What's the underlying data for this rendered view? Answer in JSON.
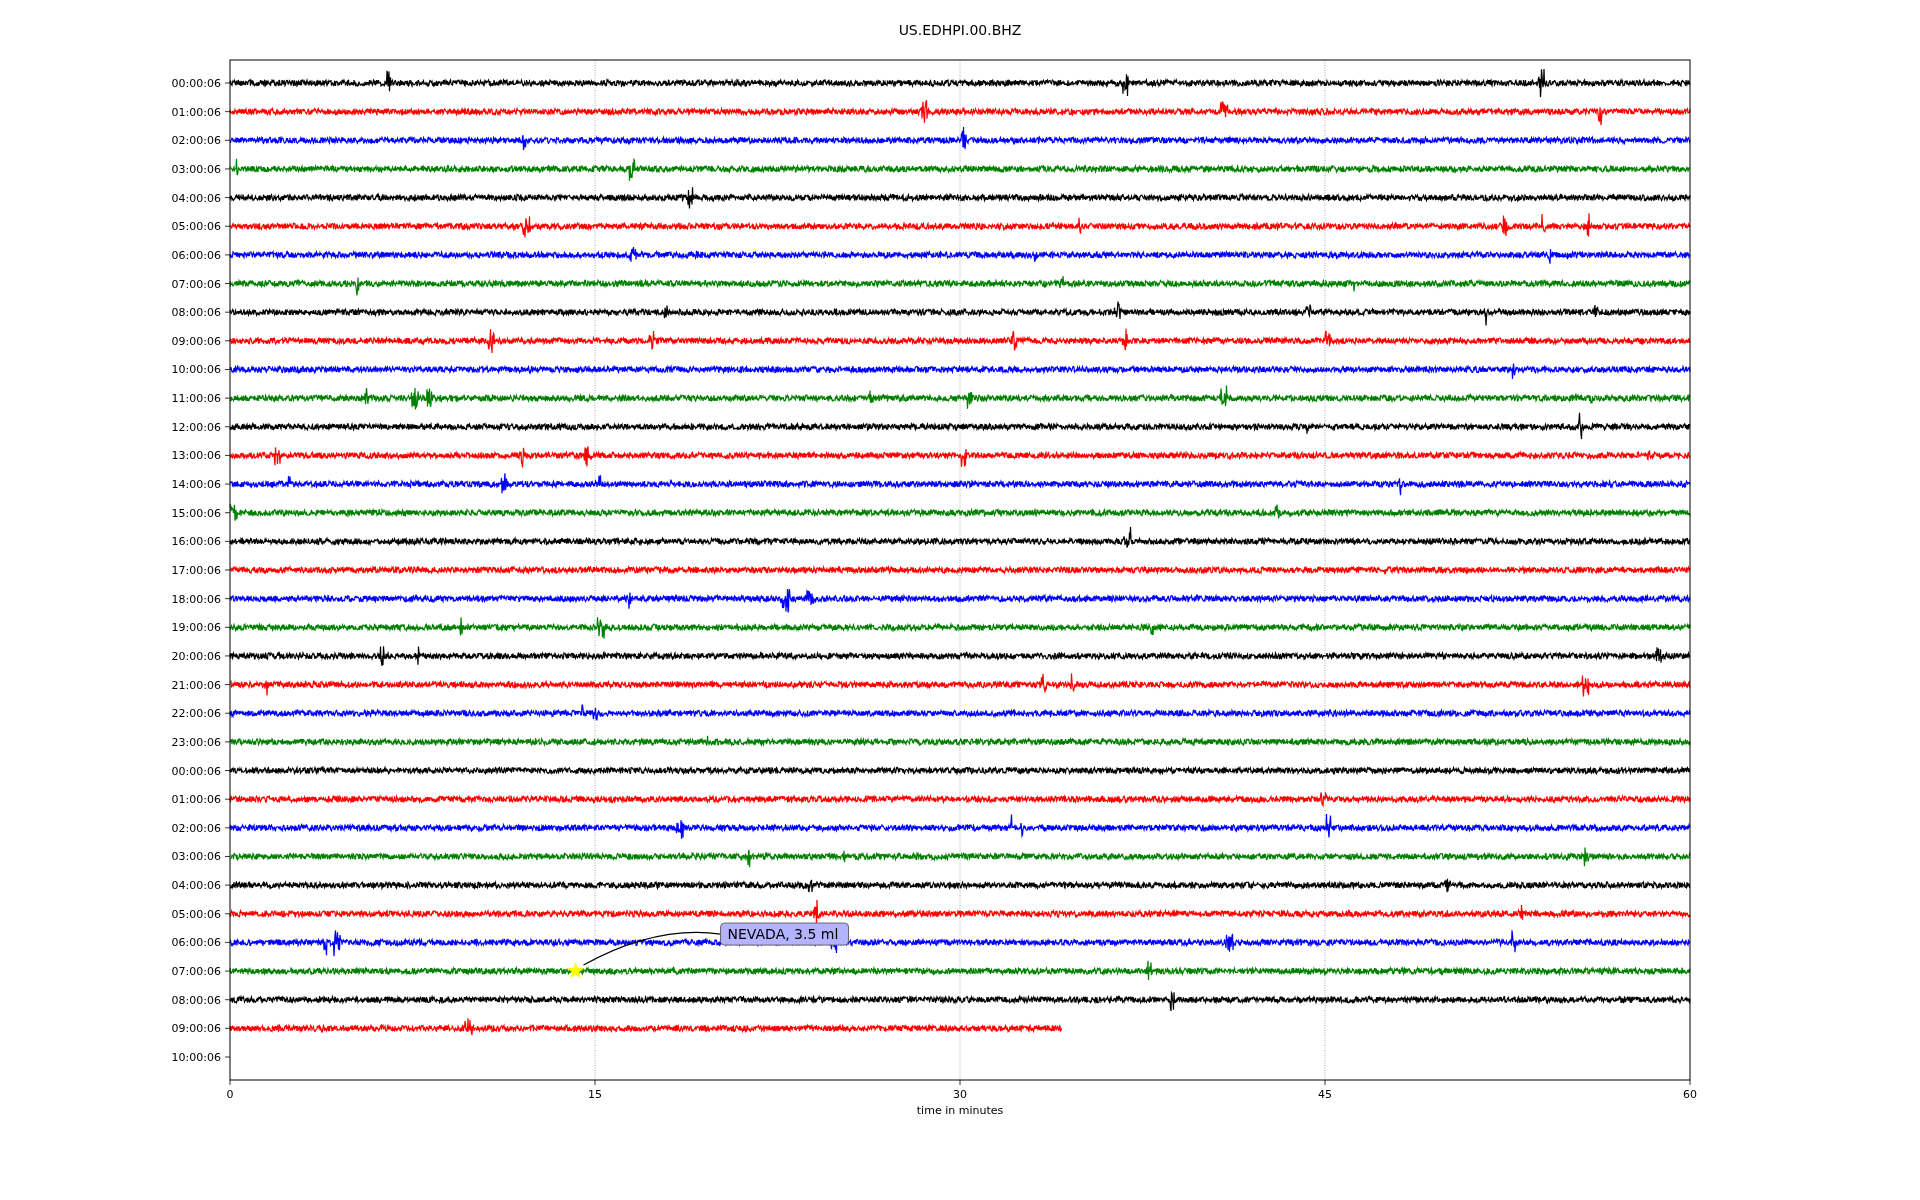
{
  "title": "US.EDHPI.00.BHZ",
  "xlabel": "time in minutes",
  "xticks": [
    "0",
    "15",
    "30",
    "45",
    "60"
  ],
  "rows": [
    {
      "label": "00:00:06",
      "color": "#000000"
    },
    {
      "label": "01:00:06",
      "color": "#ff0000"
    },
    {
      "label": "02:00:06",
      "color": "#0000ff"
    },
    {
      "label": "03:00:06",
      "color": "#008000"
    },
    {
      "label": "04:00:06",
      "color": "#000000"
    },
    {
      "label": "05:00:06",
      "color": "#ff0000"
    },
    {
      "label": "06:00:06",
      "color": "#0000ff"
    },
    {
      "label": "07:00:06",
      "color": "#008000"
    },
    {
      "label": "08:00:06",
      "color": "#000000"
    },
    {
      "label": "09:00:06",
      "color": "#ff0000"
    },
    {
      "label": "10:00:06",
      "color": "#0000ff"
    },
    {
      "label": "11:00:06",
      "color": "#008000"
    },
    {
      "label": "12:00:06",
      "color": "#000000"
    },
    {
      "label": "13:00:06",
      "color": "#ff0000"
    },
    {
      "label": "14:00:06",
      "color": "#0000ff"
    },
    {
      "label": "15:00:06",
      "color": "#008000"
    },
    {
      "label": "16:00:06",
      "color": "#000000"
    },
    {
      "label": "17:00:06",
      "color": "#ff0000"
    },
    {
      "label": "18:00:06",
      "color": "#0000ff"
    },
    {
      "label": "19:00:06",
      "color": "#008000"
    },
    {
      "label": "20:00:06",
      "color": "#000000"
    },
    {
      "label": "21:00:06",
      "color": "#ff0000"
    },
    {
      "label": "22:00:06",
      "color": "#0000ff"
    },
    {
      "label": "23:00:06",
      "color": "#008000"
    },
    {
      "label": "00:00:06",
      "color": "#000000"
    },
    {
      "label": "01:00:06",
      "color": "#ff0000"
    },
    {
      "label": "02:00:06",
      "color": "#0000ff"
    },
    {
      "label": "03:00:06",
      "color": "#008000"
    },
    {
      "label": "04:00:06",
      "color": "#000000"
    },
    {
      "label": "05:00:06",
      "color": "#ff0000"
    },
    {
      "label": "06:00:06",
      "color": "#0000ff"
    },
    {
      "label": "07:00:06",
      "color": "#008000",
      "event": {
        "label": "NEVADA, 3.5 ml"
      }
    },
    {
      "label": "08:00:06",
      "color": "#000000"
    },
    {
      "label": "09:00:06",
      "color": "#ff0000",
      "level": 0.57
    },
    {
      "label": "10:00:06"
    }
  ]
}
